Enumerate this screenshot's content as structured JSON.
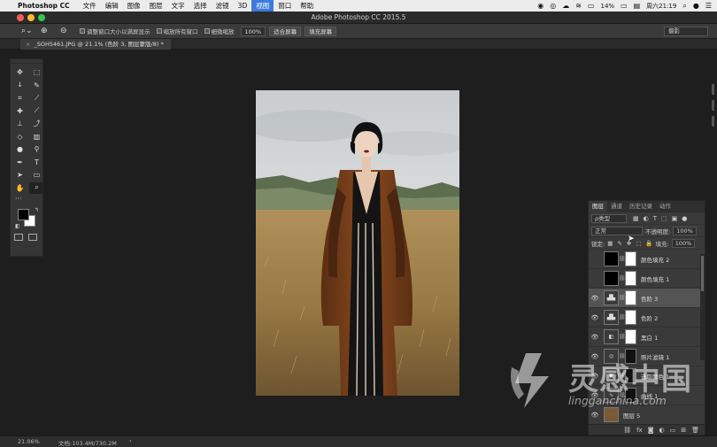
{
  "menubar": {
    "app_name": "Photoshop CC",
    "items": [
      "文件",
      "编辑",
      "图像",
      "图层",
      "文字",
      "选择",
      "滤镜",
      "3D",
      "视图",
      "窗口",
      "帮助"
    ],
    "active_item": "视图",
    "battery": "14%",
    "datetime": "周六21:19"
  },
  "window": {
    "title": "Adobe Photoshop CC 2015.5"
  },
  "options": {
    "resize_windows": "调整窗口大小以满屏显示",
    "zoom_all": "缩放所有窗口",
    "scrubby_zoom": "细微缩放",
    "zoom_value": "100%",
    "fit_screen": "适合屏幕",
    "fill_screen": "填充屏幕",
    "workspace": "摄影"
  },
  "document": {
    "tab_label": "_SOH5461.JPG @ 21.1% (色阶 3, 图层蒙版/8) *"
  },
  "status": {
    "zoom": "21.06%",
    "doc_size": "文档:103.4M/730.2M",
    "arrow": "›"
  },
  "layers_panel": {
    "tabs": [
      "图层",
      "通道",
      "历史记录",
      "动作"
    ],
    "active_tab": "图层",
    "filter_kind": "ρ类型",
    "blend_mode": "正常",
    "opacity_label": "不透明度:",
    "opacity_value": "100%",
    "lock_label": "锁定:",
    "fill_label": "填充:",
    "fill_value": "100%",
    "layers": [
      {
        "name": "颜色填充 2",
        "visible": false,
        "thumb": "black",
        "selected": false
      },
      {
        "name": "颜色填充 1",
        "visible": false,
        "thumb": "black",
        "selected": false
      },
      {
        "name": "色阶 3",
        "visible": true,
        "thumb": "levels",
        "selected": true
      },
      {
        "name": "色阶 2",
        "visible": true,
        "thumb": "levels",
        "selected": false
      },
      {
        "name": "黑白 1",
        "visible": true,
        "thumb": "bw",
        "selected": false
      },
      {
        "name": "照片滤镜 1",
        "visible": true,
        "thumb": "photo-filter",
        "selected": false
      },
      {
        "name": "选取颜色 1",
        "visible": true,
        "thumb": "selective",
        "selected": false
      },
      {
        "name": "曲线 1",
        "visible": true,
        "thumb": "curves",
        "selected": false
      },
      {
        "name": "图层 5",
        "visible": true,
        "thumb": "image",
        "selected": false
      }
    ]
  },
  "watermark": {
    "cn": "灵感中国",
    "en": "lingganchina.com"
  }
}
